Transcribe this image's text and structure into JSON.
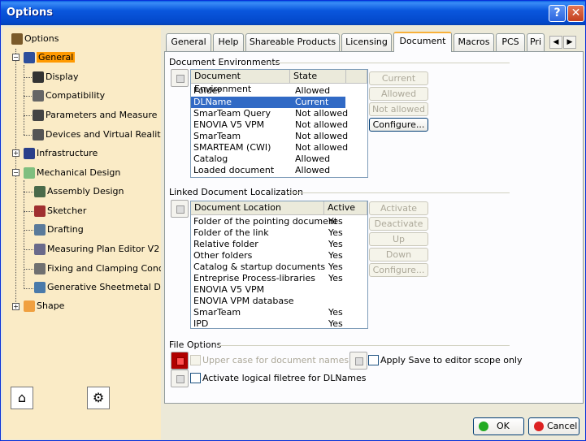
{
  "window": {
    "title": "Options",
    "help_label": "?",
    "close_label": "✕"
  },
  "tree": {
    "root": "Options",
    "items": [
      {
        "label": "General",
        "selected": true
      },
      {
        "label": "Display"
      },
      {
        "label": "Compatibility"
      },
      {
        "label": "Parameters and Measure"
      },
      {
        "label": "Devices and Virtual Reality"
      },
      {
        "label": "Infrastructure"
      },
      {
        "label": "Mechanical Design"
      },
      {
        "label": "Assembly Design"
      },
      {
        "label": "Sketcher"
      },
      {
        "label": "Drafting"
      },
      {
        "label": "Measuring Plan Editor V2"
      },
      {
        "label": "Fixing and Clamping Concept"
      },
      {
        "label": "Generative Sheetmetal Design"
      },
      {
        "label": "Shape"
      }
    ]
  },
  "tabs": [
    {
      "label": "General"
    },
    {
      "label": "Help"
    },
    {
      "label": "Shareable Products"
    },
    {
      "label": "Licensing"
    },
    {
      "label": "Document",
      "active": true
    },
    {
      "label": "Macros"
    },
    {
      "label": "PCS"
    },
    {
      "label": "Pri"
    }
  ],
  "tab_scroll": {
    "left": "◀",
    "right": "▶"
  },
  "doc_env": {
    "group_label": "Document Environments",
    "headers": [
      "Document Environment",
      "State"
    ],
    "rows": [
      [
        "Folder",
        "Allowed"
      ],
      [
        "DLName",
        "Current"
      ],
      [
        "SmarTeam Query",
        "Not allowed"
      ],
      [
        "ENOVIA V5 VPM",
        "Not allowed"
      ],
      [
        "SmarTeam",
        "Not allowed"
      ],
      [
        "SMARTEAM (CWI)",
        "Not allowed"
      ],
      [
        "Catalog",
        "Allowed"
      ],
      [
        "Loaded document",
        "Allowed"
      ]
    ],
    "selected_row": 1,
    "buttons": [
      {
        "label": "Current",
        "enabled": false
      },
      {
        "label": "Allowed",
        "enabled": false
      },
      {
        "label": "Not allowed",
        "enabled": false
      },
      {
        "label": "Configure...",
        "enabled": true
      }
    ]
  },
  "linked_doc": {
    "group_label": "Linked Document Localization",
    "headers": [
      "Document Location",
      "Active"
    ],
    "rows": [
      [
        "Folder of the pointing document",
        "Yes"
      ],
      [
        "Folder of the link",
        "Yes"
      ],
      [
        "Relative folder",
        "Yes"
      ],
      [
        "Other folders",
        "Yes"
      ],
      [
        "Catalog & startup documents",
        "Yes"
      ],
      [
        "Entreprise Process-libraries",
        "Yes"
      ],
      [
        "ENOVIA V5 VPM",
        ""
      ],
      [
        "ENOVIA VPM  database",
        ""
      ],
      [
        "SmarTeam",
        "Yes"
      ],
      [
        "IPD",
        "Yes"
      ]
    ],
    "buttons": [
      {
        "label": "Activate",
        "enabled": false
      },
      {
        "label": "Deactivate",
        "enabled": false
      },
      {
        "label": "Up",
        "enabled": false
      },
      {
        "label": "Down",
        "enabled": false
      },
      {
        "label": "Configure...",
        "enabled": false
      }
    ]
  },
  "file_options": {
    "group_label": "File Options",
    "upper_case": {
      "label": "Upper case for document names",
      "checked": false,
      "enabled": false
    },
    "apply_save": {
      "label": "Apply Save to editor scope only",
      "checked": false,
      "enabled": true
    },
    "logical_filetree": {
      "label": "Activate logical filetree for DLNames",
      "checked": false,
      "enabled": true
    }
  },
  "footer": {
    "ok_label": "OK",
    "cancel_label": "Cancel",
    "ok_color": "#22aa22",
    "cancel_color": "#dd2222"
  }
}
